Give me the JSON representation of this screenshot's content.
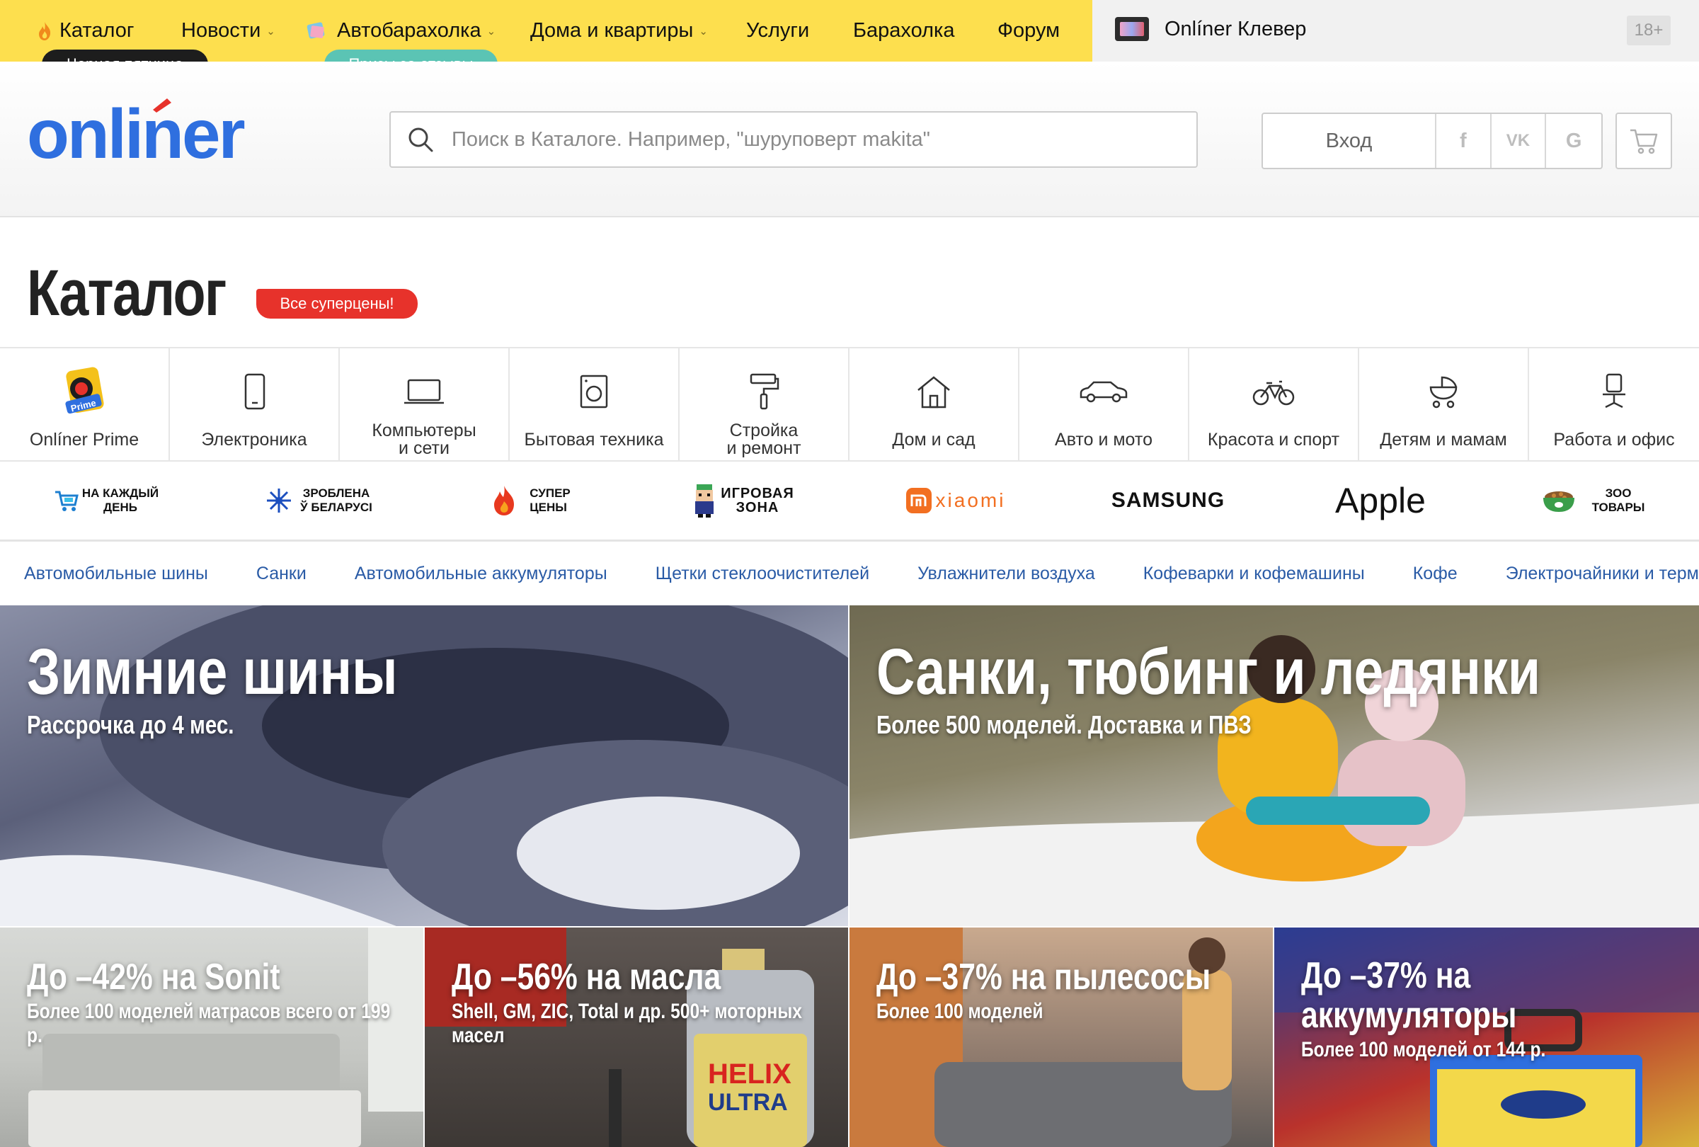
{
  "topnav": {
    "items": [
      {
        "label": "Каталог",
        "icon": "flame-icon"
      },
      {
        "label": "Новости",
        "dropdown": true
      },
      {
        "label": "Автобарахолка",
        "dropdown": true,
        "icon": "sticker-icon"
      },
      {
        "label": "Дома и квартиры",
        "dropdown": true
      },
      {
        "label": "Услуги"
      },
      {
        "label": "Барахолка"
      },
      {
        "label": "Форум"
      }
    ],
    "badge_catalog": "Черная пятница",
    "badge_auto": "Призы за отзывы",
    "clever_label": "Onlíner Клевер",
    "age_label": "18+"
  },
  "header": {
    "logo_text": "onliner",
    "search_placeholder": "Поиск в Каталоге. Например, \"шуруповерт makita\"",
    "login_label": "Вход",
    "social": [
      "f",
      "vk",
      "G"
    ]
  },
  "catalog": {
    "title": "Каталог",
    "promo_tag": "Все суперцены!",
    "categories": [
      {
        "label": "Onlíner Prime",
        "icon": "prime-icon"
      },
      {
        "label": "Электроника",
        "icon": "phone-icon"
      },
      {
        "label": "Компьютеры\nи сети",
        "icon": "laptop-icon"
      },
      {
        "label": "Бытовая техника",
        "icon": "washer-icon"
      },
      {
        "label": "Стройка\nи ремонт",
        "icon": "paint-roller-icon"
      },
      {
        "label": "Дом и сад",
        "icon": "house-icon"
      },
      {
        "label": "Авто и мото",
        "icon": "car-icon"
      },
      {
        "label": "Красота и спорт",
        "icon": "bicycle-icon"
      },
      {
        "label": "Детям и мамам",
        "icon": "stroller-icon"
      },
      {
        "label": "Работа и офис",
        "icon": "office-chair-icon"
      }
    ],
    "brands": [
      {
        "label": "НА КАЖДЫЙ\nДЕНЬ",
        "icon": "cart-icon"
      },
      {
        "label": "ЗРОБЛЕНА\nЎ БЕЛАРУСІ",
        "icon": "snowflake-icon"
      },
      {
        "label": "СУПЕР\nЦЕНЫ",
        "icon": "fire-icon"
      },
      {
        "label": "ИГРОВАЯ\nЗОНА",
        "icon": "gamer-icon"
      },
      {
        "label": "xiaomi",
        "icon": "xiaomi-logo"
      },
      {
        "label": "SAMSUNG",
        "icon": "samsung-logo"
      },
      {
        "label": "Apple",
        "icon": "apple-logo"
      },
      {
        "label": "ЗОО\nТОВАРЫ",
        "icon": "pet-bowl-icon"
      }
    ],
    "quick_links": [
      "Автомобильные шины",
      "Санки",
      "Автомобильные аккумуляторы",
      "Щетки стеклоочистителей",
      "Увлажнители воздуха",
      "Кофеварки и кофемашины",
      "Кофе",
      "Электрочайники и термопоты"
    ]
  },
  "banners": [
    {
      "title": "Зимние шины",
      "subtitle": "Рассрочка до 4 мес."
    },
    {
      "title": "Санки, тюбинг и ледянки",
      "subtitle": "Более 500 моделей. Доставка и ПВЗ"
    },
    {
      "title": "До –42% на Sonit",
      "subtitle": "Более 100 моделей матрасов всего от 199 р."
    },
    {
      "title": "До –56% на масла",
      "subtitle": "Shell, GM, ZIC, Total и др. 500+ моторных масел"
    },
    {
      "title": "До –37% на пылесосы",
      "subtitle": "Более 100 моделей"
    },
    {
      "title": "До –37% на\nаккумуляторы",
      "subtitle": "Более 100 моделей от 144 р."
    }
  ],
  "colors": {
    "topbar": "#fddf4e",
    "brand_blue": "#2f6fdf",
    "accent_red": "#e7322b",
    "badge_teal": "#5bc4b4",
    "link": "#2a5ba6"
  }
}
